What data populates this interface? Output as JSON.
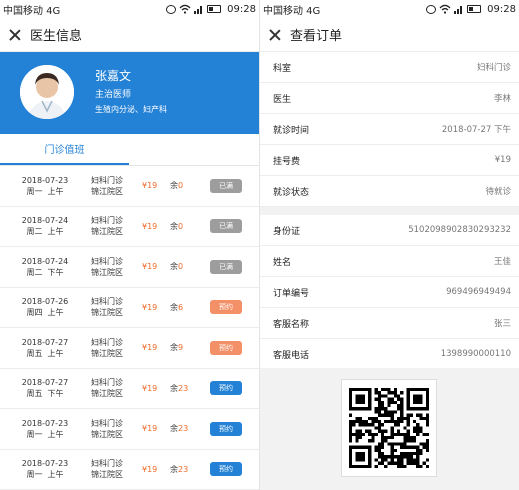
{
  "status": {
    "carrier": "中国移动 4G",
    "time": "09:28"
  },
  "doctor_screen": {
    "title": "医生信息",
    "doctor": {
      "name": "张嘉文",
      "title": "主治医师",
      "specialty": "生殖内分泌、妇产科"
    },
    "tab": "门诊值班",
    "remaining_prefix": "余",
    "schedules": [
      {
        "date": "2018-07-23",
        "weekday": "周一",
        "period": "上午",
        "dept": "妇科门诊",
        "campus": "锦江院区",
        "fee": "¥19",
        "left": "0",
        "action": "已满",
        "state": "full"
      },
      {
        "date": "2018-07-24",
        "weekday": "周二",
        "period": "上午",
        "dept": "妇科门诊",
        "campus": "锦江院区",
        "fee": "¥19",
        "left": "0",
        "action": "已满",
        "state": "full"
      },
      {
        "date": "2018-07-24",
        "weekday": "周二",
        "period": "下午",
        "dept": "妇科门诊",
        "campus": "锦江院区",
        "fee": "¥19",
        "left": "0",
        "action": "已满",
        "state": "full"
      },
      {
        "date": "2018-07-26",
        "weekday": "周四",
        "period": "上午",
        "dept": "妇科门诊",
        "campus": "锦江院区",
        "fee": "¥19",
        "left": "6",
        "action": "预约",
        "state": "few"
      },
      {
        "date": "2018-07-27",
        "weekday": "周五",
        "period": "上午",
        "dept": "妇科门诊",
        "campus": "锦江院区",
        "fee": "¥19",
        "left": "9",
        "action": "预约",
        "state": "few"
      },
      {
        "date": "2018-07-27",
        "weekday": "周五",
        "period": "下午",
        "dept": "妇科门诊",
        "campus": "锦江院区",
        "fee": "¥19",
        "left": "23",
        "action": "预约",
        "state": "avail"
      },
      {
        "date": "2018-07-23",
        "weekday": "周一",
        "period": "上午",
        "dept": "妇科门诊",
        "campus": "锦江院区",
        "fee": "¥19",
        "left": "23",
        "action": "预约",
        "state": "avail"
      },
      {
        "date": "2018-07-23",
        "weekday": "周一",
        "period": "上午",
        "dept": "妇科门诊",
        "campus": "锦江院区",
        "fee": "¥19",
        "left": "23",
        "action": "预约",
        "state": "avail"
      }
    ]
  },
  "order_screen": {
    "title": "查看订单",
    "visit_info": [
      {
        "label": "科室",
        "value": "妇科门诊"
      },
      {
        "label": "医生",
        "value": "李林"
      },
      {
        "label": "就诊时间",
        "value": "2018-07-27   下午"
      },
      {
        "label": "挂号费",
        "value": "¥19"
      },
      {
        "label": "就诊状态",
        "value": "待就诊"
      }
    ],
    "patient_info": [
      {
        "label": "身份证",
        "value": "5102098902830293232"
      },
      {
        "label": "姓名",
        "value": "王佳"
      },
      {
        "label": "订单编号",
        "value": "969496949494"
      },
      {
        "label": "客服名称",
        "value": "张三"
      },
      {
        "label": "客服电话",
        "value": "1398990000110"
      }
    ]
  },
  "colors": {
    "primary": "#2482d6",
    "accent": "#f06a2a",
    "full_button": "#9d9d9d",
    "few_button": "#f39068"
  },
  "icons": [
    "close-icon",
    "alarm-icon",
    "wifi-icon",
    "signal-icon",
    "battery-icon",
    "qr-code"
  ]
}
